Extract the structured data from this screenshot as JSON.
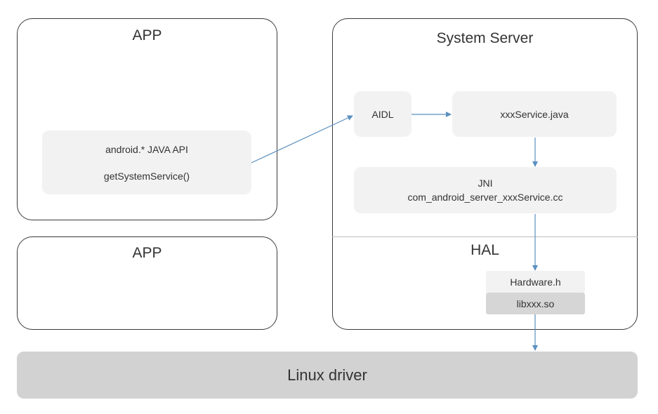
{
  "app_top": {
    "title": "APP",
    "api_line1": "android.*  JAVA API",
    "api_line2": "getSystemService()"
  },
  "app_bottom": {
    "title": "APP"
  },
  "system_server": {
    "title": "System Server",
    "aidl": "AIDL",
    "service": "xxxService.java",
    "jni_line1": "JNI",
    "jni_line2": "com_android_server_xxxService.cc"
  },
  "hal": {
    "title": "HAL",
    "hardware": "Hardware.h",
    "lib": "libxxx.so"
  },
  "linux": {
    "label": "Linux driver"
  },
  "colors": {
    "arrow": "#5b8fbf",
    "node_fill": "#f2f2f2",
    "linux_fill": "#d2d2d2",
    "border": "#3a3a3a"
  }
}
